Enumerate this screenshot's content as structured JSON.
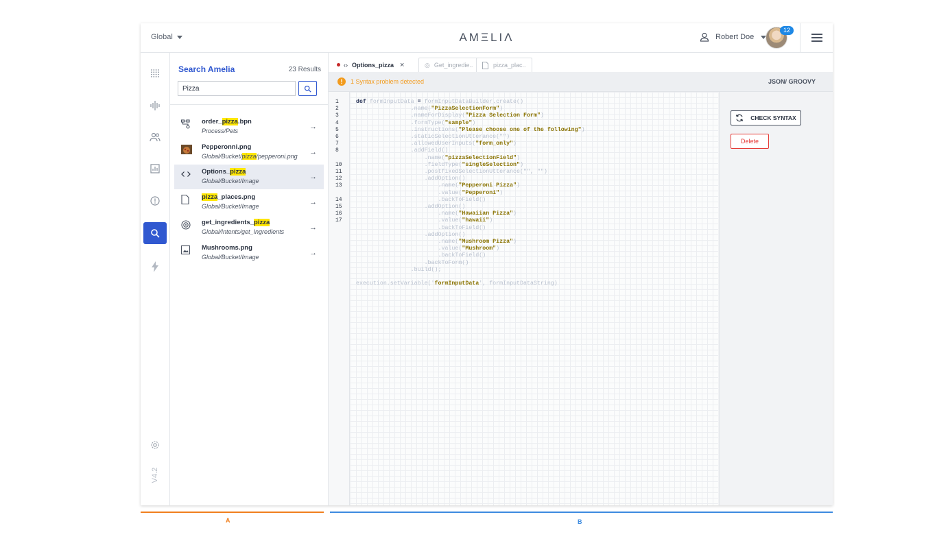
{
  "header": {
    "scope_label": "Global",
    "logo": "AMΞLIΛ",
    "user_name": "Robert Doe",
    "notification_count": "12"
  },
  "rail": {
    "version": "V4.2",
    "items": [
      "apps-grid-icon",
      "waveform-icon",
      "users-icon",
      "analytics-icon",
      "alert-icon",
      "search-icon",
      "bolt-icon"
    ],
    "accent": "#3058d0"
  },
  "search": {
    "title": "Search Amelia",
    "results_count": "23 Results",
    "query": "Pizza",
    "results": [
      {
        "title_pre": "order_",
        "title_hl": "pizza",
        "title_post": ".bpn",
        "path_pre": "Process/Pets",
        "path_hl": "",
        "path_post": "",
        "icon": "process-icon"
      },
      {
        "title_pre": "Pepperonni.png",
        "title_hl": "",
        "title_post": "",
        "path_pre": "Global/Bucket/",
        "path_hl": "pizza",
        "path_post": "/pepperoni.png",
        "icon": "image-thumbnail"
      },
      {
        "title_pre": "Options_",
        "title_hl": "pizza",
        "title_post": "",
        "path_pre": "Global/Bucket/Image",
        "path_hl": "",
        "path_post": "",
        "icon": "code-icon"
      },
      {
        "title_pre": "",
        "title_hl": "pizza",
        "title_post": "_places.png",
        "path_pre": "Global/Bucket/Image",
        "path_hl": "",
        "path_post": "",
        "icon": "file-icon"
      },
      {
        "title_pre": "get_ingredients_",
        "title_hl": "pizza",
        "title_post": "",
        "path_pre": "Global/Intents/get_Ingredients",
        "path_hl": "",
        "path_post": "",
        "icon": "target-icon"
      },
      {
        "title_pre": "Mushrooms.png",
        "title_hl": "",
        "title_post": "",
        "path_pre": "Global/Bucket/Image",
        "path_hl": "",
        "path_post": "",
        "icon": "image-icon"
      }
    ]
  },
  "tabs": [
    {
      "label": "Options_pizza",
      "active": true
    },
    {
      "label": "Get_ingredie..",
      "active": false
    },
    {
      "label": "pizza_plac..",
      "active": false
    }
  ],
  "status": {
    "warning": "1 Syntax problem detected",
    "language": "JSON/ GROOVY",
    "warning_color": "#f29b1d"
  },
  "editor": {
    "line_numbers": [
      "1",
      "2",
      "3",
      "4",
      "5",
      "6",
      "7",
      "8",
      "10",
      "11",
      "12",
      "13",
      "14",
      "15",
      "16",
      "17"
    ],
    "lines": [
      [
        [
          "kw",
          "def"
        ],
        [
          "p",
          " formInputData "
        ],
        [
          "kw",
          "="
        ],
        [
          "p",
          " formInputDataBuilder.create()"
        ]
      ],
      [
        [
          "p",
          "                .name("
        ],
        [
          "s",
          "\"PizzaSelectionForm\""
        ],
        [
          "p",
          ")"
        ]
      ],
      [
        [
          "p",
          "                .nameForDisplay("
        ],
        [
          "s",
          "\"Pizza Selection Form\""
        ],
        [
          "p",
          ")"
        ]
      ],
      [
        [
          "p",
          "                .formType("
        ],
        [
          "s",
          "\"sample\""
        ],
        [
          "p",
          ")"
        ]
      ],
      [
        [
          "p",
          "                .instructions("
        ],
        [
          "s",
          "\"Please choose one of the following\""
        ],
        [
          "p",
          ")"
        ]
      ],
      [
        [
          "p",
          "                .staticSelectionUtterance(\"\")"
        ]
      ],
      [
        [
          "p",
          "                .allowedUserInputs("
        ],
        [
          "s",
          "\"form_only\""
        ],
        [
          "p",
          ")"
        ]
      ],
      [
        [
          "p",
          "                .addField()"
        ]
      ],
      [
        [
          "p",
          "                    .name("
        ],
        [
          "s",
          "\"pizzaSelectionField\""
        ],
        [
          "p",
          ")"
        ]
      ],
      [
        [
          "p",
          "                    .fieldType("
        ],
        [
          "s",
          "\"singleSelection\""
        ],
        [
          "p",
          ")"
        ]
      ],
      [
        [
          "p",
          "                    .postfixedSelectionUtterance(\"\", \"\")"
        ]
      ],
      [
        [
          "p",
          "                    .addOption()"
        ]
      ],
      [
        [
          "p",
          "                        .name("
        ],
        [
          "s",
          "\"Pepperoni Pizza\""
        ],
        [
          "p",
          ")"
        ]
      ],
      [
        [
          "p",
          "                        .value("
        ],
        [
          "s",
          "\"Pepperoni\""
        ],
        [
          "p",
          ")"
        ]
      ],
      [
        [
          "p",
          "                        .backToField()"
        ]
      ],
      [
        [
          "p",
          "                    .addOption()"
        ]
      ],
      [
        [
          "p",
          "                        .name("
        ],
        [
          "s",
          "\"Hawaiian Pizza\""
        ],
        [
          "p",
          ")"
        ]
      ],
      [
        [
          "p",
          "                        .value("
        ],
        [
          "s",
          "\"hawaii\""
        ],
        [
          "p",
          ")"
        ]
      ],
      [
        [
          "p",
          "                        .backToField()"
        ]
      ],
      [
        [
          "p",
          "                    .addOption()"
        ]
      ],
      [
        [
          "p",
          "                        .name("
        ],
        [
          "s",
          "\"Mushroom Pizza\""
        ],
        [
          "p",
          ")"
        ]
      ],
      [
        [
          "p",
          "                        .value("
        ],
        [
          "s",
          "\"Mushroom\""
        ],
        [
          "p",
          ")"
        ]
      ],
      [
        [
          "p",
          "                        .backToField()"
        ]
      ],
      [
        [
          "p",
          "                    .backToForm()"
        ]
      ],
      [
        [
          "p",
          "                .build();"
        ]
      ],
      [
        [
          "p",
          ""
        ]
      ],
      [
        [
          "p",
          "execution.setVariable('"
        ],
        [
          "s",
          "formInputData"
        ],
        [
          "p",
          "', formInputDataString)"
        ]
      ]
    ]
  },
  "actions": {
    "check_syntax": "CHECK SYNTAX",
    "delete": "Delete",
    "delete_color": "#e53935"
  },
  "annotations": {
    "a": "A",
    "b": "B",
    "a_color": "#f07f1e",
    "b_color": "#3d8be0"
  }
}
